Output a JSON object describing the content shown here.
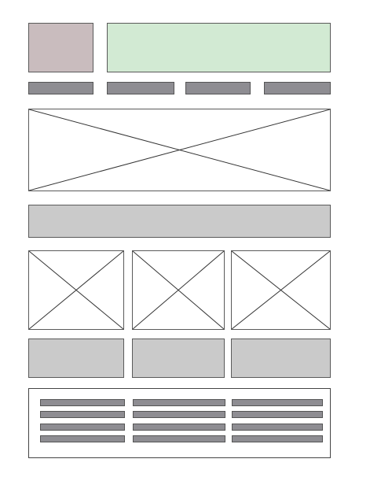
{
  "wireframe": {
    "colors": {
      "logo": "#c9bcbe",
      "banner": "#d2ead3",
      "nav": "#8e8d92",
      "content_bar": "#cacaca",
      "card": "#cacaca",
      "footer_line": "#8e8d92",
      "outline": "#5a5a5a"
    },
    "nav_item_count": 4,
    "thumbnail_count": 3,
    "card_count": 3,
    "footer_columns": 3,
    "footer_rows": 4
  }
}
